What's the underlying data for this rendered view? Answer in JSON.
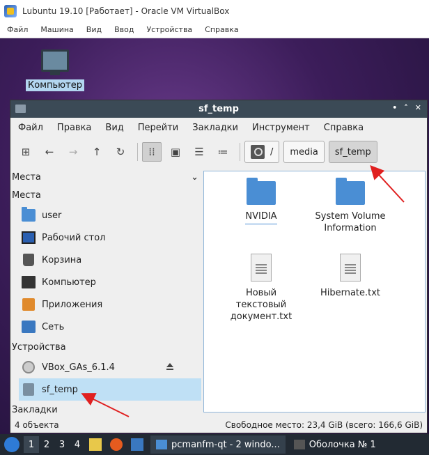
{
  "host": {
    "title": "Lubuntu 19.10 [Работает] - Oracle VM VirtualBox",
    "menu": [
      "Файл",
      "Машина",
      "Вид",
      "Ввод",
      "Устройства",
      "Справка"
    ]
  },
  "desktop": {
    "icon_label": "Компьютер"
  },
  "window": {
    "title": "sf_temp",
    "controls": [
      "•",
      "˄",
      "✕"
    ],
    "menu": [
      "Файл",
      "Правка",
      "Вид",
      "Перейти",
      "Закладки",
      "Инструмент",
      "Справка"
    ],
    "breadcrumbs": [
      "/",
      "media",
      "sf_temp"
    ],
    "active_breadcrumb": "sf_temp"
  },
  "sidebar": {
    "header": "Места",
    "places_title": "Места",
    "places": [
      {
        "label": "user",
        "icon": "home-folder-icon"
      },
      {
        "label": "Рабочий стол",
        "icon": "desktop-icon"
      },
      {
        "label": "Корзина",
        "icon": "trash-icon"
      },
      {
        "label": "Компьютер",
        "icon": "computer-icon"
      },
      {
        "label": "Приложения",
        "icon": "applications-icon"
      },
      {
        "label": "Сеть",
        "icon": "network-icon"
      }
    ],
    "devices_title": "Устройства",
    "devices": [
      {
        "label": "VBox_GAs_6.1.4",
        "icon": "cdrom-icon"
      },
      {
        "label": "sf_temp",
        "icon": "drive-icon",
        "selected": true
      }
    ],
    "bookmarks_title": "Закладки"
  },
  "files": [
    {
      "name": "NVIDIA",
      "type": "folder"
    },
    {
      "name": "System Volume\nInformation",
      "type": "folder"
    },
    {
      "name": "Новый\nтекстовый\nдокумент.txt",
      "type": "text"
    },
    {
      "name": "Hibernate.txt",
      "type": "text"
    }
  ],
  "status": {
    "count": "4 объекта",
    "free_space": "Свободное место: 23,4 GiB (всего: 166,6 GiB)"
  },
  "taskbar": {
    "workspaces": [
      "1",
      "2",
      "3",
      "4"
    ],
    "active_workspace": "1",
    "tasks": [
      "pcmanfm-qt - 2 windo...",
      "Оболочка № 1"
    ]
  },
  "colors": {
    "annotation_arrow": "#e02020",
    "selection": "#bfe0f5",
    "title_bar": "#3b4a56"
  }
}
